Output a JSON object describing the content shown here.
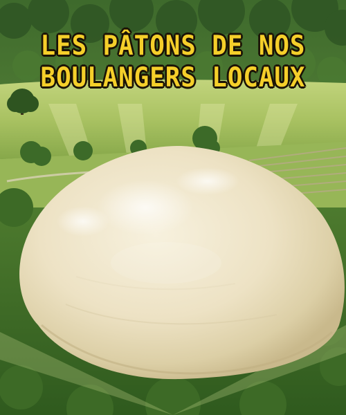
{
  "headline": {
    "line1": "LES PÂTONS DE NOS",
    "line2": "BOULANGERS LOCAUX"
  },
  "colors": {
    "headline_fill": "#f5cf2a",
    "headline_outline": "#1a1206",
    "sky_haze": "#cfe0b0",
    "field_green": "#a9c46a",
    "dough": "#efe6cc"
  },
  "icons": {
    "background": "countryside-landscape",
    "subject": "bread-dough-ball"
  }
}
